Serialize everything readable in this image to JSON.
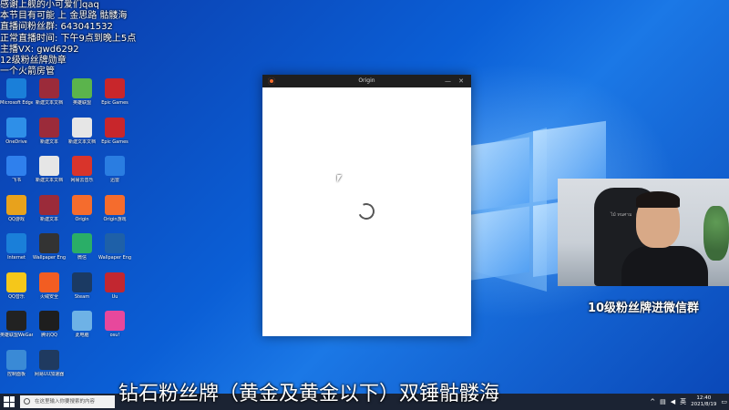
{
  "overlay": {
    "lines": [
      "感谢上舰的小可爱们qaq",
      "本节目有可能 上 金思路 骷髅海",
      "直播间粉丝群: 643041532",
      "正常直播时间: 下午9点到晚上5点",
      "主播VX: gwd6292",
      "12级粉丝牌勋章",
      "一个火箭房管"
    ]
  },
  "desktop": {
    "icons": [
      {
        "label": "Microsoft Edge",
        "icon": "edge-icon",
        "color": "#1a7fd9"
      },
      {
        "label": "新建文本文档",
        "icon": "winrar-icon",
        "color": "#9b2b3a"
      },
      {
        "label": "英雄联盟",
        "icon": "bilibili-icon",
        "color": "#5bb44c"
      },
      {
        "label": "Epic Games",
        "icon": "adobe-icon",
        "color": "#c8262b"
      },
      {
        "label": "OneDrive",
        "icon": "onedrive-icon",
        "color": "#2e8fe8"
      },
      {
        "label": "新建文本",
        "icon": "winrar-icon",
        "color": "#9b2b3a"
      },
      {
        "label": "新建文本文档",
        "icon": "file-icon",
        "color": "#e6e6e6"
      },
      {
        "label": "Epic Games",
        "icon": "adobe-icon",
        "color": "#c8262b"
      },
      {
        "label": "飞书",
        "icon": "feishu-icon",
        "color": "#2f80ed"
      },
      {
        "label": "新建文本文档",
        "icon": "file-icon",
        "color": "#e6e6e6"
      },
      {
        "label": "网易云音乐",
        "icon": "netease-icon",
        "color": "#d9342b"
      },
      {
        "label": "迅雷",
        "icon": "xunlei-icon",
        "color": "#2a7de1"
      },
      {
        "label": "QQ游戏",
        "icon": "game-icon",
        "color": "#e8a21c"
      },
      {
        "label": "新建文本",
        "icon": "winrar-icon",
        "color": "#9b2b3a"
      },
      {
        "label": "Origin",
        "icon": "origin-icon",
        "color": "#f56c2d"
      },
      {
        "label": "Origin游戏",
        "icon": "origin-icon",
        "color": "#f56c2d"
      },
      {
        "label": "Internet",
        "icon": "ie-icon",
        "color": "#1a7fd9"
      },
      {
        "label": "Wallpaper Engine",
        "icon": "engine-icon",
        "color": "#333"
      },
      {
        "label": "微信",
        "icon": "wechat-icon",
        "color": "#2aae67"
      },
      {
        "label": "Wallpaper Engine",
        "icon": "engine-icon",
        "color": "#1e60a8"
      },
      {
        "label": "QQ音乐",
        "icon": "qqmusic-icon",
        "color": "#f5c71a"
      },
      {
        "label": "火绒安全",
        "icon": "huorong-icon",
        "color": "#f25d22"
      },
      {
        "label": "Steam",
        "icon": "steam-icon",
        "color": "#1b3a63"
      },
      {
        "label": "Uu",
        "icon": "uu-icon",
        "color": "#c22730"
      },
      {
        "label": "英雄联盟WeGame",
        "icon": "wegame-icon",
        "color": "#222"
      },
      {
        "label": "腾讯QQ",
        "icon": "qq-icon",
        "color": "#1e1e1e"
      },
      {
        "label": "此电脑",
        "icon": "computer-icon",
        "color": "#6eb2e6"
      },
      {
        "label": "osu!",
        "icon": "osu-icon",
        "color": "#e7489c"
      },
      {
        "label": "控制面板",
        "icon": "panel-icon",
        "color": "#3a8ad6"
      },
      {
        "label": "网易UU加速器",
        "icon": "uu-icon",
        "color": "#1f3a60"
      }
    ]
  },
  "origin_window": {
    "title": "Origin",
    "minimize": "—",
    "close": "✕"
  },
  "webcam": {
    "chair_text": "ไม้ ทนศาม"
  },
  "captions": {
    "fans": "10级粉丝牌进微信群",
    "bottom": "钻石粉丝牌（黄金及黄金以下）双锤骷髅海"
  },
  "taskbar": {
    "search_placeholder": "在这里输入你要搜索的内容",
    "time": "12:40",
    "date": "2021/8/19",
    "ime": "英"
  }
}
